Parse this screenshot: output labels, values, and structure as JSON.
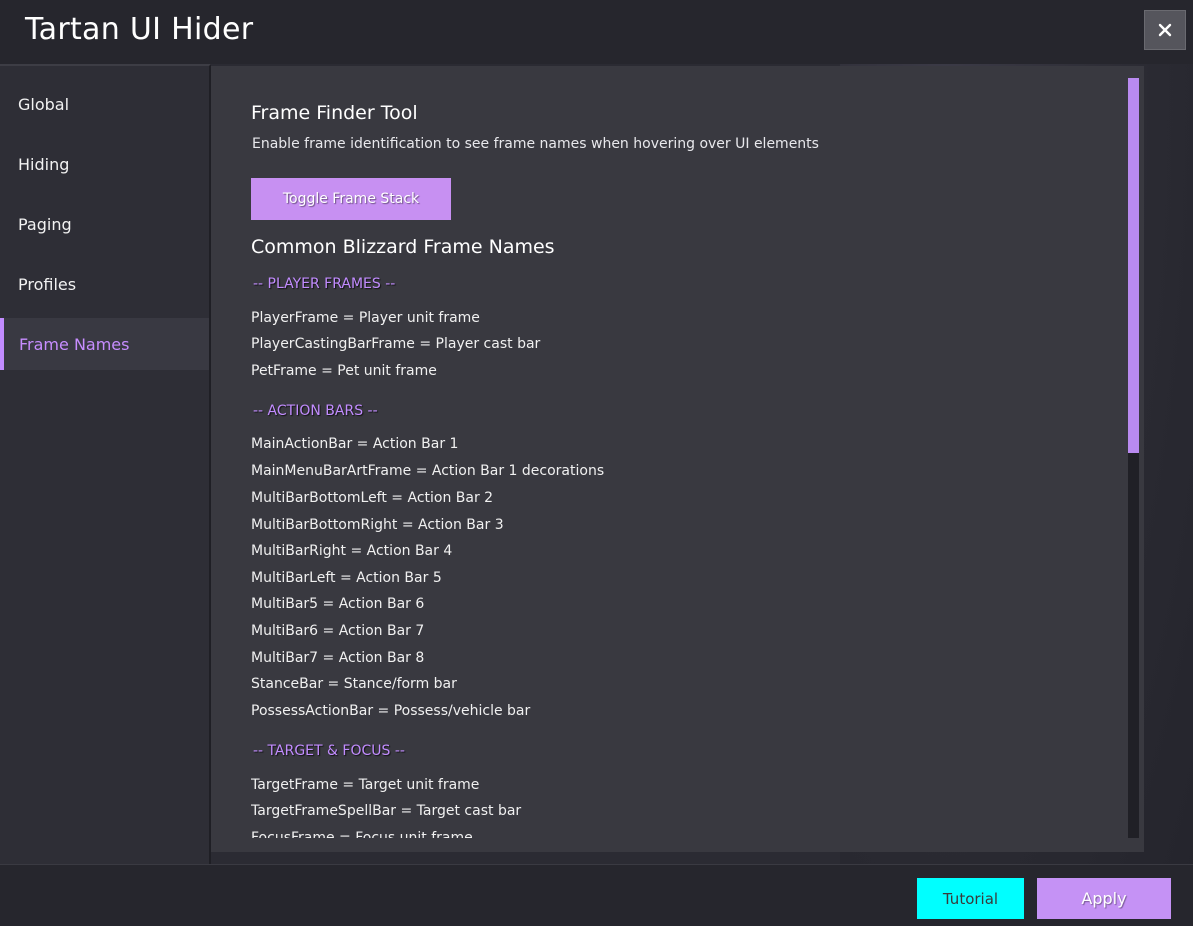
{
  "window": {
    "title": "Tartan UI Hider",
    "close_label": "✕"
  },
  "sidebar": {
    "items": [
      {
        "label": "Global",
        "active": false
      },
      {
        "label": "Hiding",
        "active": false
      },
      {
        "label": "Paging",
        "active": false
      },
      {
        "label": "Profiles",
        "active": false
      },
      {
        "label": "Frame Names",
        "active": true
      }
    ]
  },
  "main": {
    "tool_title": "Frame Finder Tool",
    "tool_description": "Enable frame identification to see frame names when hovering over UI elements",
    "toggle_button_label": "Toggle Frame Stack",
    "names_title": "Common Blizzard Frame Names",
    "groups": [
      {
        "header": "-- PLAYER FRAMES --",
        "entries": [
          "PlayerFrame = Player unit frame",
          "PlayerCastingBarFrame = Player cast bar",
          "PetFrame = Pet unit frame"
        ]
      },
      {
        "header": "-- ACTION BARS --",
        "entries": [
          "MainActionBar = Action Bar 1",
          "MainMenuBarArtFrame = Action Bar 1 decorations",
          "MultiBarBottomLeft = Action Bar 2",
          "MultiBarBottomRight = Action Bar 3",
          "MultiBarRight = Action Bar 4",
          "MultiBarLeft = Action Bar 5",
          "MultiBar5 = Action Bar 6",
          "MultiBar6 = Action Bar 7",
          "MultiBar7 = Action Bar 8",
          "StanceBar = Stance/form bar",
          "PossessActionBar = Possess/vehicle bar"
        ]
      },
      {
        "header": "-- TARGET & FOCUS --",
        "entries": [
          "TargetFrame = Target unit frame",
          "TargetFrameSpellBar = Target cast bar",
          "FocusFrame = Focus unit frame"
        ]
      }
    ],
    "scroll_position": 0
  },
  "footer": {
    "tutorial_label": "Tutorial",
    "apply_label": "Apply"
  },
  "colors": {
    "accent": "#c28cff",
    "tutorial": "#00ffff",
    "panel": "#393940",
    "sidebar": "#2e2e36",
    "titlebar": "#26262d"
  }
}
